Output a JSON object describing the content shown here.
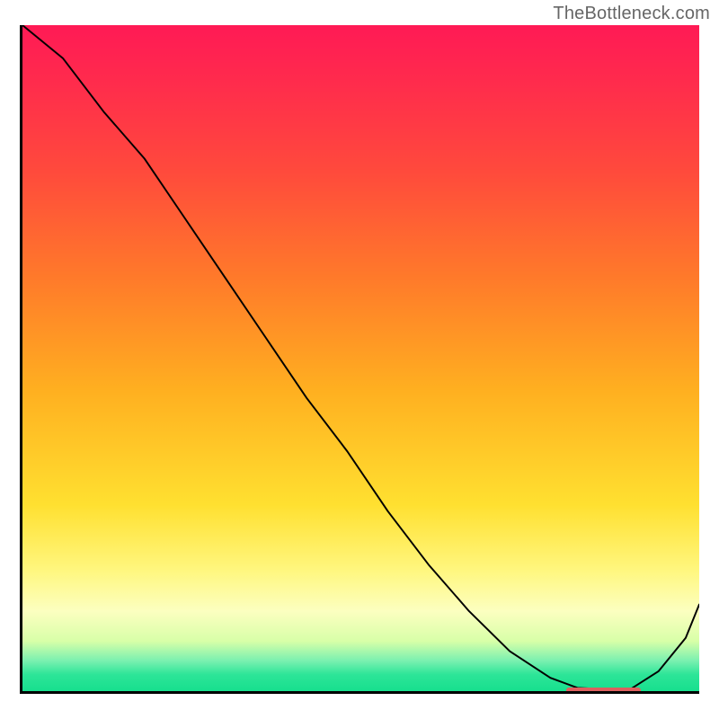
{
  "watermark": "TheBottleneck.com",
  "chart_data": {
    "type": "line",
    "title": "",
    "xlabel": "",
    "ylabel": "",
    "x": [
      0.0,
      0.06,
      0.12,
      0.18,
      0.24,
      0.3,
      0.36,
      0.42,
      0.48,
      0.54,
      0.6,
      0.66,
      0.72,
      0.78,
      0.82,
      0.86,
      0.9,
      0.94,
      0.98,
      1.0
    ],
    "values": [
      100,
      95,
      87,
      80,
      71,
      62,
      53,
      44,
      36,
      27,
      19,
      12,
      6,
      2,
      0.5,
      0.3,
      0.4,
      3,
      8,
      13
    ],
    "xlim": [
      0,
      1
    ],
    "ylim": [
      0,
      100
    ],
    "background_gradient": {
      "orientation": "vertical",
      "stops": [
        {
          "pos": 0.0,
          "color": "#ff1a55"
        },
        {
          "pos": 0.22,
          "color": "#ff4a3c"
        },
        {
          "pos": 0.55,
          "color": "#ffb020"
        },
        {
          "pos": 0.82,
          "color": "#fff780"
        },
        {
          "pos": 0.95,
          "color": "#78f0b0"
        },
        {
          "pos": 1.0,
          "color": "#17df8e"
        }
      ]
    },
    "marker": {
      "x_start": 0.8,
      "x_end": 0.91,
      "y": 0.5,
      "color": "#dd605e"
    }
  }
}
